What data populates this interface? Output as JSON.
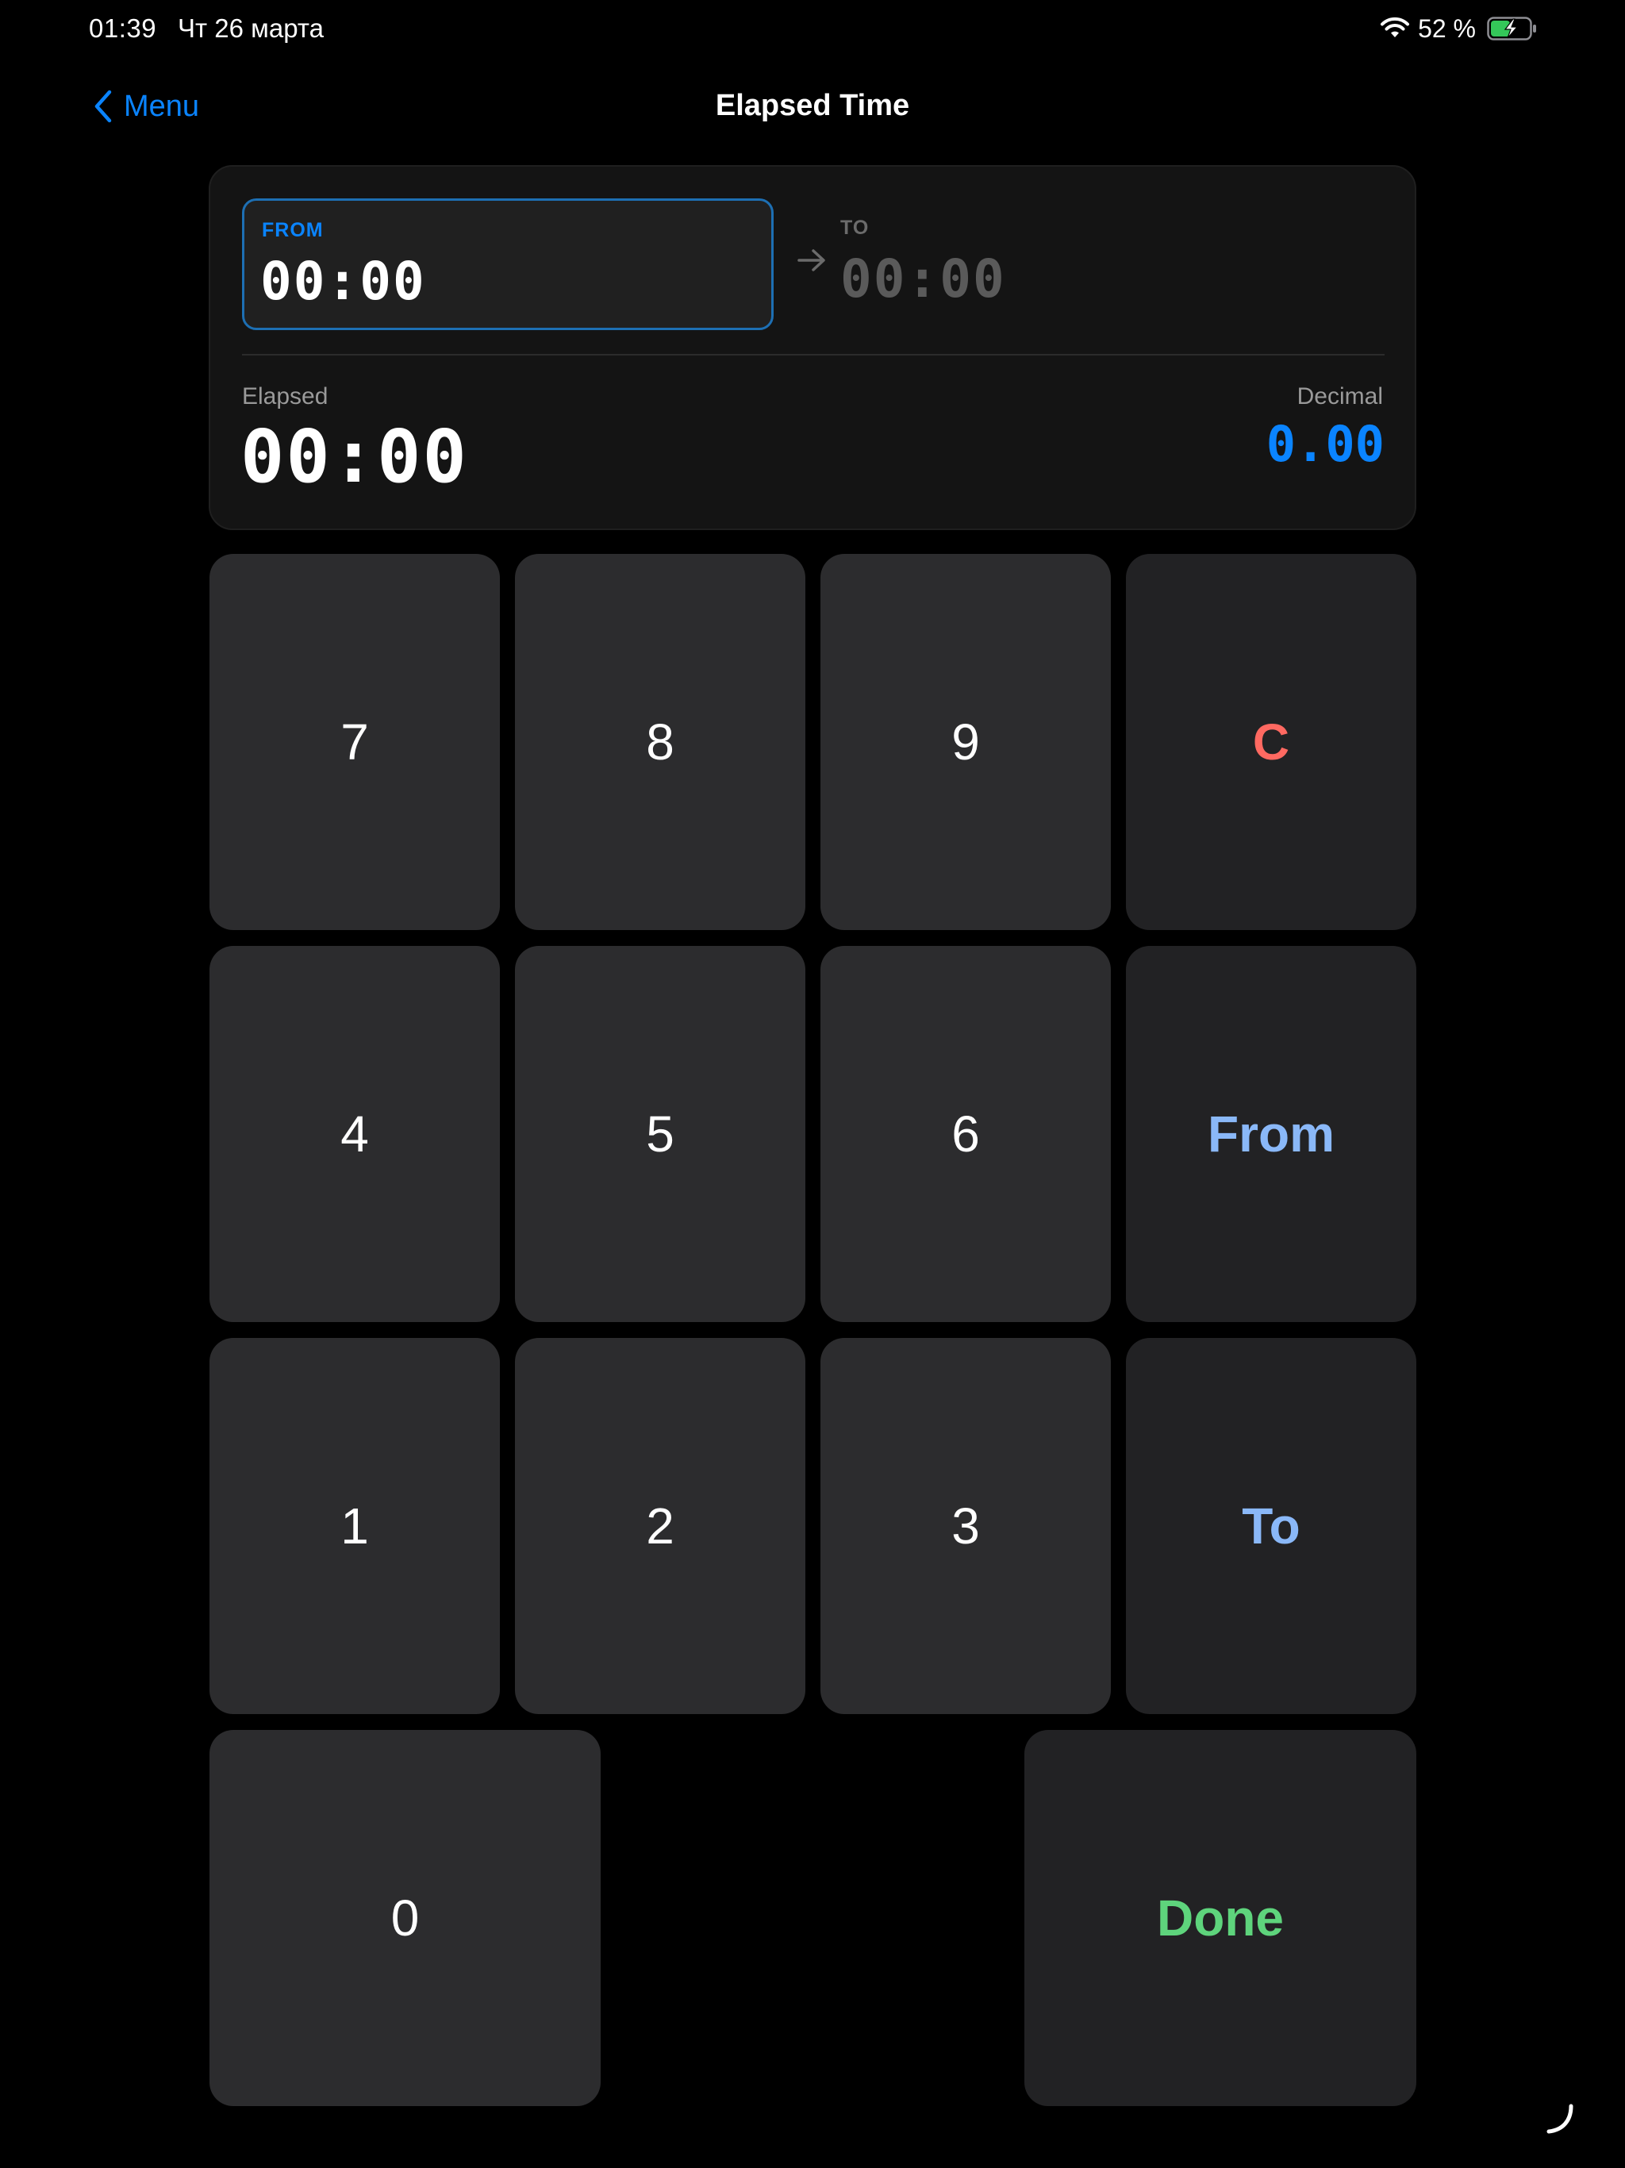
{
  "status_bar": {
    "time": "01:39",
    "date": "Чт 26 марта",
    "battery_percent": "52 %",
    "battery_level": 0.52,
    "charging": true,
    "icons": [
      "wifi-icon",
      "battery-charging-icon"
    ]
  },
  "nav": {
    "back_label": "Menu",
    "back_icon": "chevron-left-icon",
    "title": "Elapsed Time"
  },
  "display": {
    "from_label": "FROM",
    "from_value": "00:00",
    "to_label": "TO",
    "to_value": "00:00",
    "elapsed_label": "Elapsed",
    "elapsed_value": "00:00",
    "decimal_label": "Decimal",
    "decimal_value": "0.00",
    "active_field": "from"
  },
  "keypad": {
    "keys": {
      "k7": "7",
      "k8": "8",
      "k9": "9",
      "clear": "C",
      "k4": "4",
      "k5": "5",
      "k6": "6",
      "from": "From",
      "k1": "1",
      "k2": "2",
      "k3": "3",
      "to": "To",
      "k0": "0",
      "done": "Done"
    }
  },
  "colors": {
    "accent": "#0a84ff",
    "clear": "#ff6961",
    "field_keys": "#8ab8f8",
    "done": "#5ed47c",
    "background": "#000000",
    "card": "#141414",
    "key": "#2c2c2e"
  }
}
